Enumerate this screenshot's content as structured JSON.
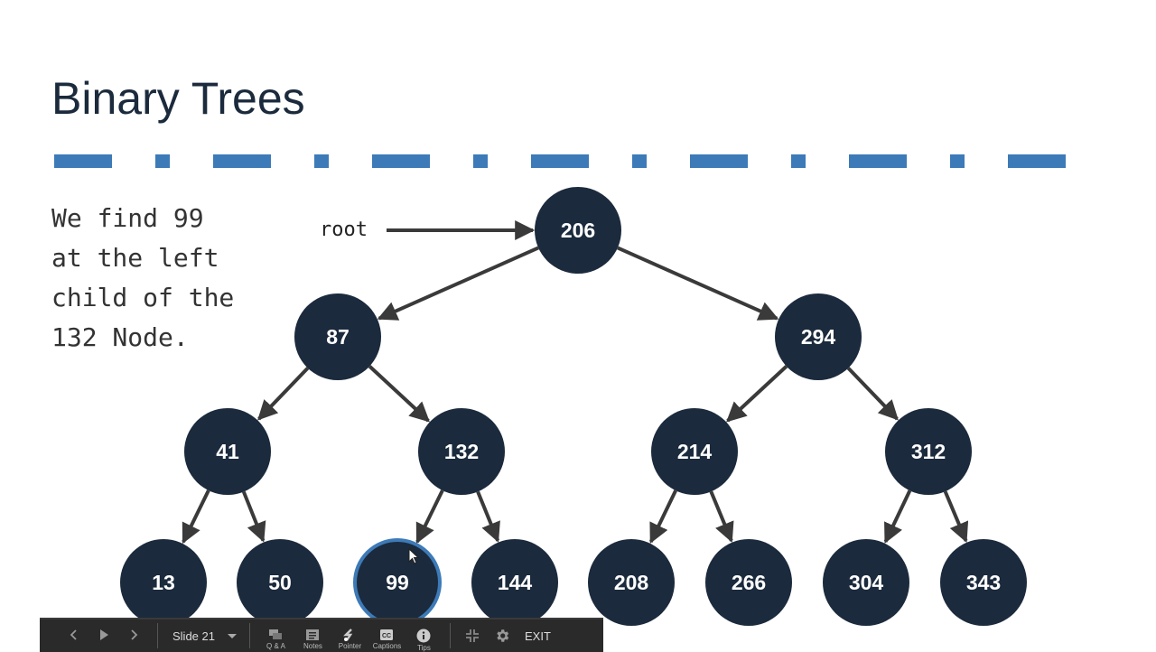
{
  "slide": {
    "title": "Binary Trees",
    "description": "We find 99\nat the left\nchild of the\n132 Node.",
    "root_label": "root",
    "colors": {
      "node_fill": "#1b2a3c",
      "highlight_ring": "#3d7ab8",
      "divider": "#3d7ab8",
      "arrow": "#3a3a3a"
    }
  },
  "tree": {
    "highlighted": "99",
    "nodes": [
      {
        "id": "206",
        "label": "206",
        "level": 0
      },
      {
        "id": "87",
        "label": "87",
        "level": 1
      },
      {
        "id": "294",
        "label": "294",
        "level": 1
      },
      {
        "id": "41",
        "label": "41",
        "level": 2
      },
      {
        "id": "132",
        "label": "132",
        "level": 2
      },
      {
        "id": "214",
        "label": "214",
        "level": 2
      },
      {
        "id": "312",
        "label": "312",
        "level": 2
      },
      {
        "id": "13",
        "label": "13",
        "level": 3
      },
      {
        "id": "50",
        "label": "50",
        "level": 3
      },
      {
        "id": "99",
        "label": "99",
        "level": 3
      },
      {
        "id": "144",
        "label": "144",
        "level": 3
      },
      {
        "id": "208",
        "label": "208",
        "level": 3
      },
      {
        "id": "266",
        "label": "266",
        "level": 3
      },
      {
        "id": "304",
        "label": "304",
        "level": 3
      },
      {
        "id": "343",
        "label": "343",
        "level": 3
      }
    ],
    "edges": [
      [
        "206",
        "87"
      ],
      [
        "206",
        "294"
      ],
      [
        "87",
        "41"
      ],
      [
        "87",
        "132"
      ],
      [
        "294",
        "214"
      ],
      [
        "294",
        "312"
      ],
      [
        "41",
        "13"
      ],
      [
        "41",
        "50"
      ],
      [
        "132",
        "99"
      ],
      [
        "132",
        "144"
      ],
      [
        "214",
        "208"
      ],
      [
        "214",
        "266"
      ],
      [
        "312",
        "304"
      ],
      [
        "312",
        "343"
      ]
    ]
  },
  "toolbar": {
    "prev_icon": "chevron-left-icon",
    "play_icon": "play-icon",
    "next_icon": "chevron-right-icon",
    "slide_selector": "Slide 21",
    "buttons": [
      {
        "label": "Q & A",
        "icon": "qa-icon"
      },
      {
        "label": "Notes",
        "icon": "notes-icon"
      },
      {
        "label": "Pointer",
        "icon": "pointer-icon"
      },
      {
        "label": "Captions",
        "icon": "captions-icon"
      },
      {
        "label": "Tips",
        "icon": "info-icon"
      }
    ],
    "exit_fullscreen_icon": "exit-fullscreen-icon",
    "settings_icon": "gear-icon",
    "exit_label": "EXIT"
  }
}
